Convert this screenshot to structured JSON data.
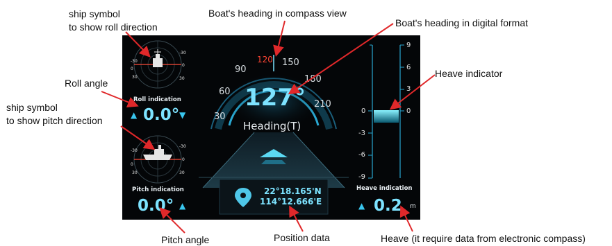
{
  "annotations": {
    "ship_roll_line1": "ship symbol",
    "ship_roll_line2": "to show roll direction",
    "heading_compass": "Boat's heading in compass view",
    "heading_digital": "Boat's heading in digital format",
    "roll_angle": "Roll angle",
    "heave_indicator": "Heave indicator",
    "ship_pitch_line1": "ship symbol",
    "ship_pitch_line2": "to show pitch direction",
    "pitch_angle": "Pitch angle",
    "position_data": "Position data",
    "heave_note": "Heave (it require data from electronic compass)"
  },
  "roll": {
    "label": "Roll indication",
    "value": "0.0°",
    "scale_left": [
      "-30",
      "0",
      "30"
    ],
    "scale_right": [
      "-30",
      "0",
      "30"
    ]
  },
  "pitch": {
    "label": "Pitch indication",
    "value": "0.0°",
    "scale_left": [
      "-30",
      "0",
      "30"
    ],
    "scale_right": [
      "-30",
      "0",
      "30"
    ]
  },
  "heading": {
    "value": "127°",
    "label": "Heading(T)",
    "compass_labels": [
      "30",
      "60",
      "90",
      "120",
      "150",
      "180",
      "210"
    ],
    "highlight_label": "120",
    "highlight_color": "#ff4433"
  },
  "position": {
    "lat": "22°18.165'N",
    "lon": "114°12.666'E"
  },
  "heave": {
    "label": "Heave indication",
    "value": "0.2",
    "unit": "m",
    "scale_left": [
      "0",
      "-3",
      "-6",
      "-9"
    ],
    "scale_right": [
      "9",
      "6",
      "3",
      "0"
    ]
  },
  "colors": {
    "accent": "#7de3ff",
    "panel_bg": "#040608",
    "annotation_line": "#e0282a"
  }
}
